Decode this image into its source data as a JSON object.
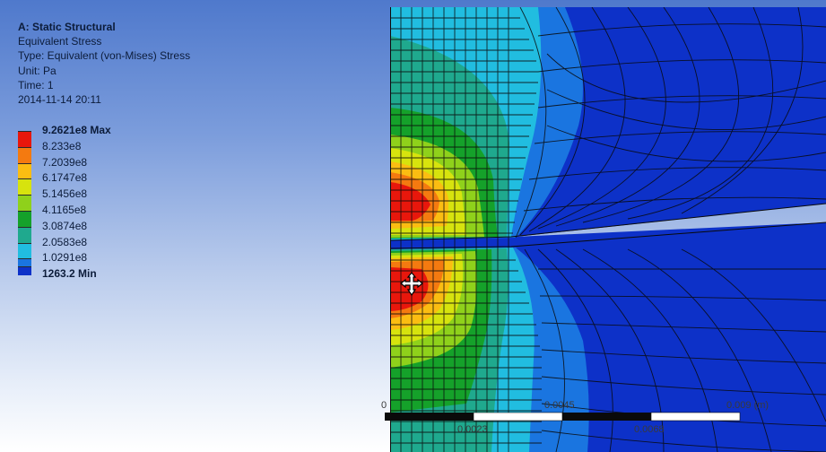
{
  "info": {
    "title": "A: Static Structural",
    "result": "Equivalent Stress",
    "type": "Type: Equivalent (von-Mises) Stress",
    "unit": "Unit: Pa",
    "time": "Time: 1",
    "date": "2014-11-14 20:11"
  },
  "legend": {
    "max_label": "9.2621e8 Max",
    "min_label": "1263.2 Min",
    "values": [
      "8.233e8",
      "7.2039e8",
      "6.1747e8",
      "5.1456e8",
      "4.1165e8",
      "3.0874e8",
      "2.0583e8",
      "1.0291e8"
    ],
    "colors": [
      "#e8170c",
      "#f47a10",
      "#fbbd12",
      "#d7e30e",
      "#8fd11b",
      "#15a12a",
      "#1fa98e",
      "#21bde0",
      "#1a75e0",
      "#0d31c8"
    ]
  },
  "scale": {
    "labels_top": [
      "0",
      "0.0045",
      "0.009 (m)"
    ],
    "labels_bottom": [
      "0.0023",
      "0.0068"
    ]
  },
  "colors": {
    "background_top": "#4f79cc",
    "background_bottom": "#ffffff",
    "mesh_line": "#0a0a0a"
  }
}
